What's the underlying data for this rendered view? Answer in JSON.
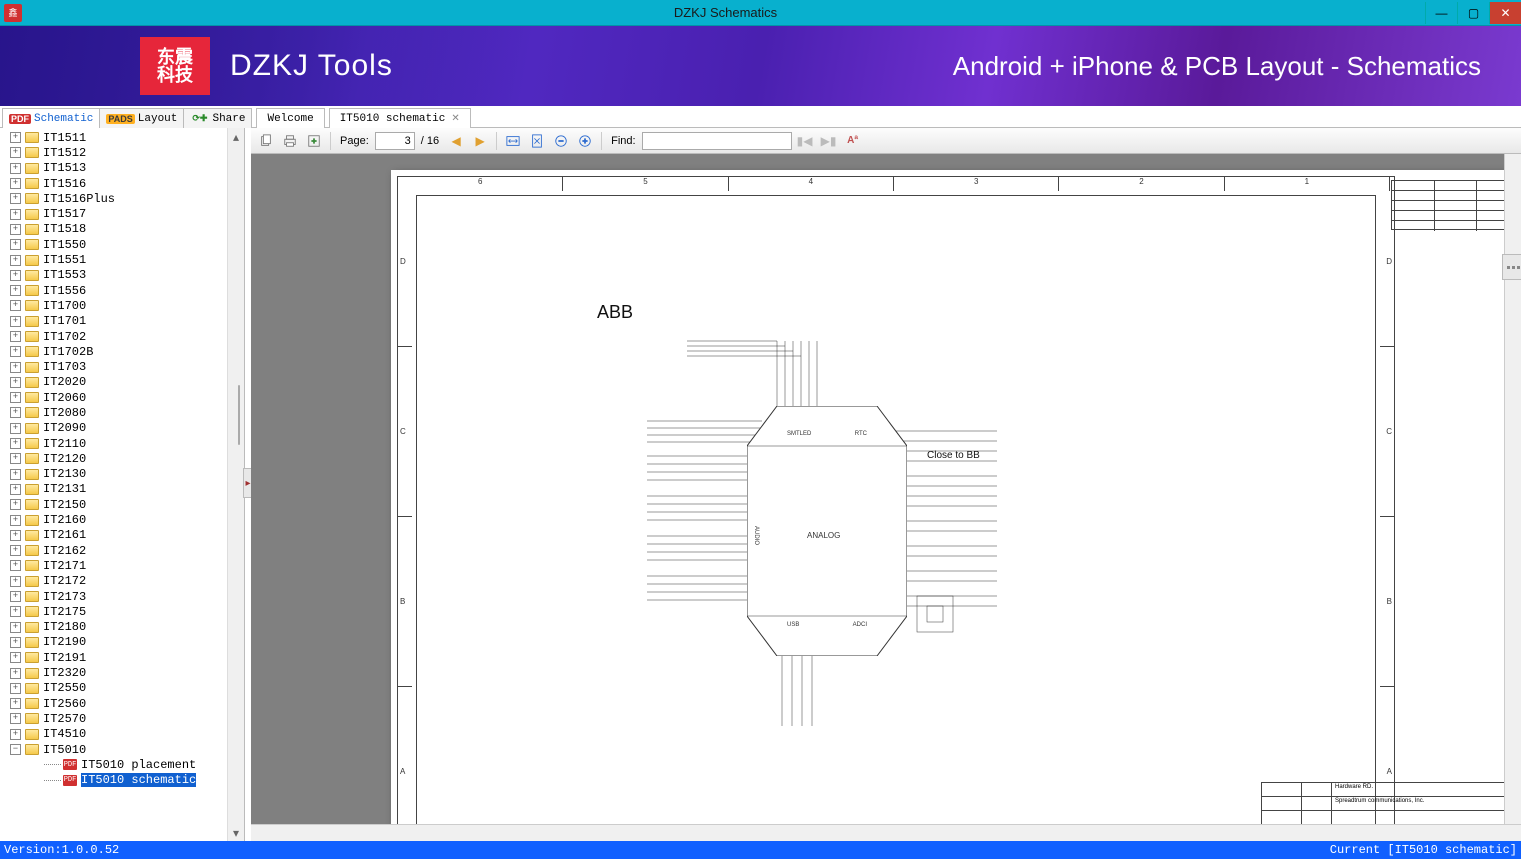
{
  "window": {
    "title": "DZKJ Schematics"
  },
  "banner": {
    "logo_cn": "东震\n科技",
    "brand": "DZKJ Tools",
    "tagline": "Android + iPhone & PCB Layout - Schematics"
  },
  "mode_tabs": {
    "schematic": "Schematic",
    "layout": "Layout",
    "share": "Share"
  },
  "doc_tabs": {
    "welcome": "Welcome",
    "current": "IT5010 schematic"
  },
  "toolbar": {
    "page_label": "Page:",
    "page_current": "3",
    "page_total": "/ 16",
    "find_label": "Find:"
  },
  "tree": {
    "items": [
      "IT1511",
      "IT1512",
      "IT1513",
      "IT1516",
      "IT1516Plus",
      "IT1517",
      "IT1518",
      "IT1550",
      "IT1551",
      "IT1553",
      "IT1556",
      "IT1700",
      "IT1701",
      "IT1702",
      "IT1702B",
      "IT1703",
      "IT2020",
      "IT2060",
      "IT2080",
      "IT2090",
      "IT2110",
      "IT2120",
      "IT2130",
      "IT2131",
      "IT2150",
      "IT2160",
      "IT2161",
      "IT2162",
      "IT2171",
      "IT2172",
      "IT2173",
      "IT2175",
      "IT2180",
      "IT2190",
      "IT2191",
      "IT2320",
      "IT2550",
      "IT2560",
      "IT2570",
      "IT4510",
      "IT5010"
    ],
    "children": {
      "placement": "IT5010 placement",
      "schematic": "IT5010 schematic"
    }
  },
  "schematic": {
    "block_title": "ABB",
    "chip_center": "ANALOG",
    "chip_top_left": "SMTLED",
    "chip_top_right": "RTC",
    "chip_bot_left": "USB",
    "chip_bot_right": "ADCI",
    "chip_side": "AUDIO",
    "note_right": "Close to BB",
    "cols": [
      "6",
      "5",
      "4",
      "3",
      "2",
      "1"
    ],
    "rows": [
      "D",
      "C",
      "B",
      "A"
    ],
    "titleblock": {
      "hw": "Hardware RD.",
      "company": "Spreadtrum communications, Inc."
    }
  },
  "status": {
    "version": "Version:1.0.0.52",
    "current": "Current [IT5010 schematic]"
  }
}
